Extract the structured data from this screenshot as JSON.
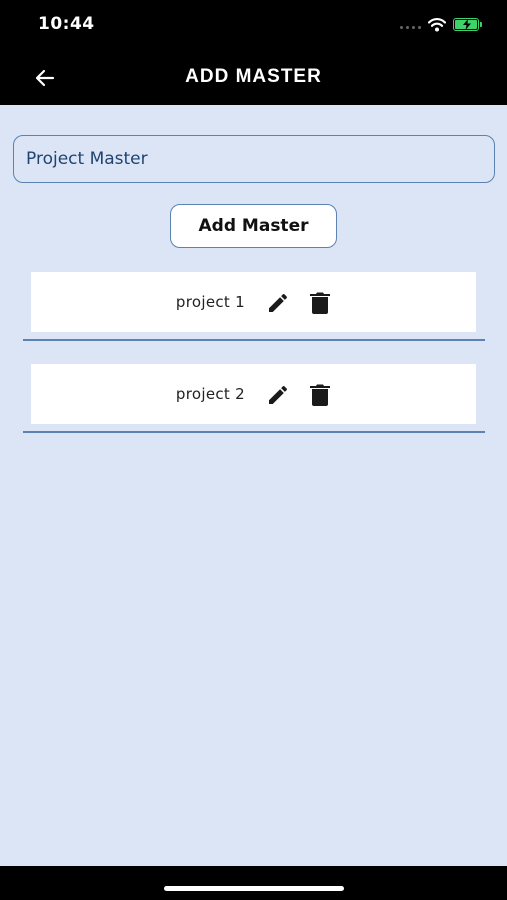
{
  "status_bar": {
    "time": "10:44"
  },
  "header": {
    "title": "ADD MASTER"
  },
  "form": {
    "input_value": "Project Master",
    "add_button_label": "Add Master"
  },
  "list": {
    "items": [
      {
        "label": "project 1"
      },
      {
        "label": "project 2"
      }
    ]
  },
  "icons": {
    "back": "arrow-left-icon",
    "edit": "pencil-icon",
    "delete": "trash-icon",
    "wifi": "wifi-icon",
    "battery": "battery-charging-icon"
  },
  "colors": {
    "background": "#dbe5f6",
    "header": "#000000",
    "accent_border": "#5b82b0",
    "input_text": "#1f4470",
    "battery": "#3fd26a"
  }
}
